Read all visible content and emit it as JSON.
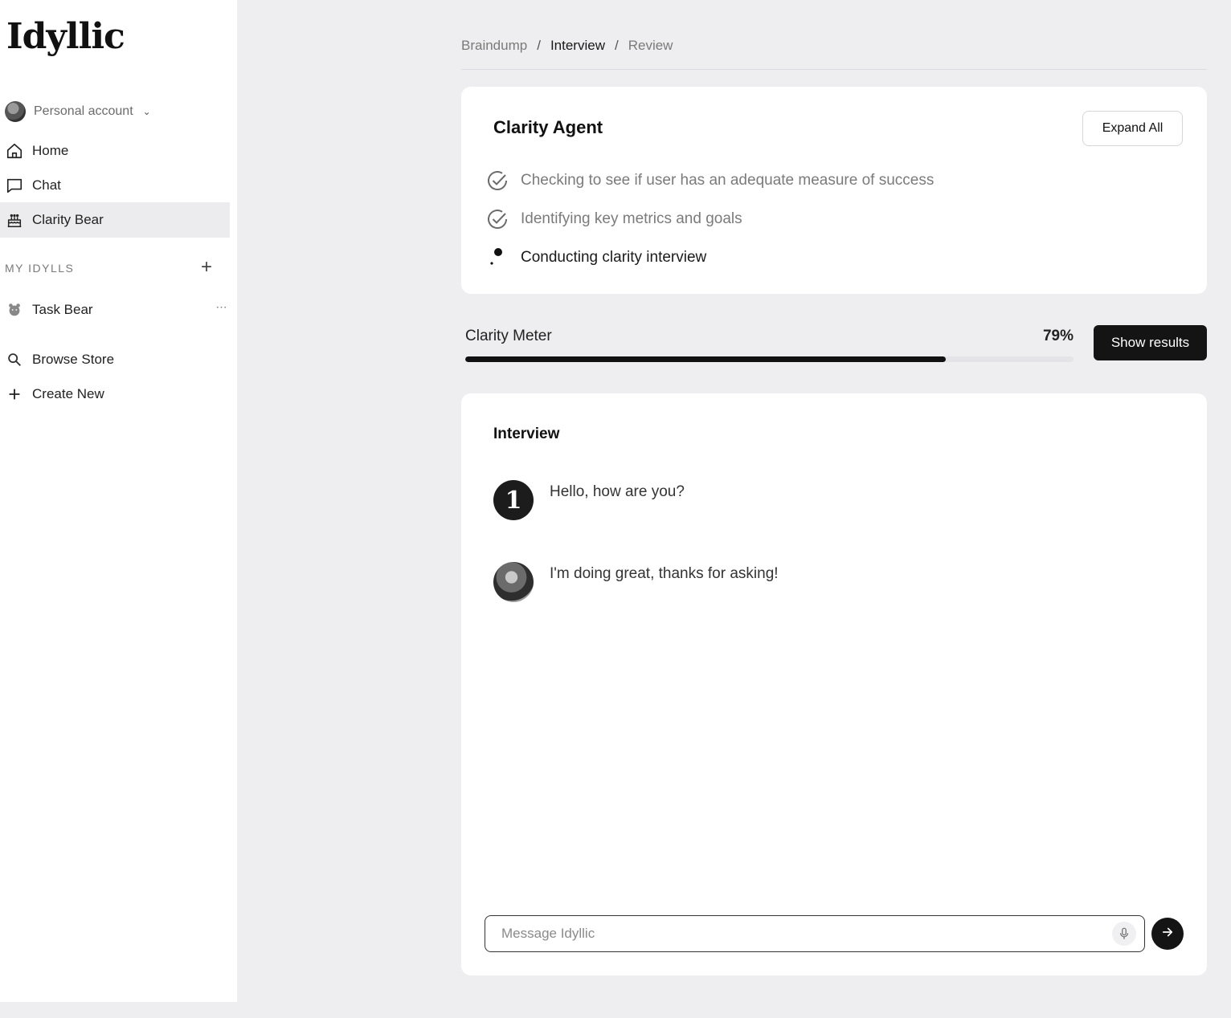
{
  "app": {
    "logo": "Idyllic"
  },
  "sidebar": {
    "account_label": "Personal account",
    "nav": [
      {
        "label": "Home",
        "icon": "home-icon"
      },
      {
        "label": "Chat",
        "icon": "chat-icon"
      },
      {
        "label": "Clarity Bear",
        "icon": "cake-icon",
        "active": true
      }
    ],
    "section_label": "MY IDYLLS",
    "idylls": [
      {
        "label": "Task Bear",
        "icon": "bear-icon"
      }
    ],
    "links": [
      {
        "label": "Browse Store",
        "icon": "search-icon"
      },
      {
        "label": "Create New",
        "icon": "plus-icon"
      }
    ]
  },
  "breadcrumb": {
    "items": [
      "Braindump",
      "Interview",
      "Review"
    ],
    "separator": "/",
    "current_index": 1
  },
  "agent": {
    "title": "Clarity Agent",
    "expand_label": "Expand All",
    "steps": [
      {
        "text": "Checking to see if user has an adequate measure of success",
        "status": "done"
      },
      {
        "text": "Identifying key metrics and goals",
        "status": "done"
      },
      {
        "text": "Conducting clarity interview",
        "status": "in-progress"
      }
    ]
  },
  "meter": {
    "label": "Clarity Meter",
    "value_text": "79%",
    "fill_fraction": 0.79,
    "button_label": "Show results"
  },
  "interview": {
    "title": "Interview",
    "messages": [
      {
        "sender": "bot",
        "avatar_letter": "1",
        "text": "Hello, how are you?"
      },
      {
        "sender": "user",
        "text": "I'm doing great, thanks for asking!"
      }
    ],
    "input_placeholder": "Message Idyllic"
  },
  "colors": {
    "background": "#eeeef1",
    "surface": "#ffffff",
    "accent": "#141414",
    "muted_text": "#7b7b7b"
  }
}
